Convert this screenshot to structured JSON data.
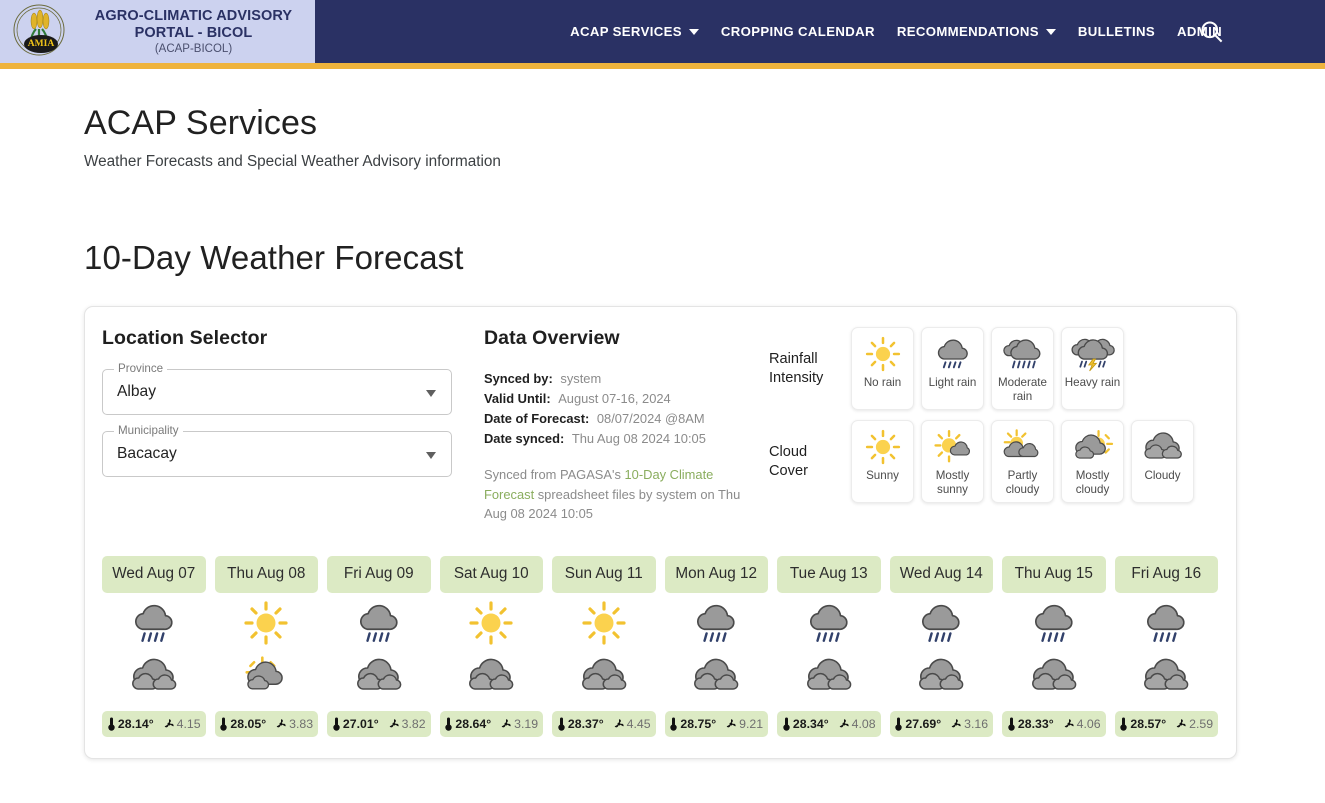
{
  "header": {
    "logo_icon": "pamia-seal-logo",
    "brand_title_line1": "AGRO-CLIMATIC ADVISORY",
    "brand_title_line2": "PORTAL - BICOL",
    "brand_subtitle": "(ACAP-BICOL)",
    "nav": [
      {
        "label": "ACAP SERVICES",
        "has_caret": true
      },
      {
        "label": "CROPPING CALENDAR",
        "has_caret": false
      },
      {
        "label": "RECOMMENDATIONS",
        "has_caret": true
      },
      {
        "label": "BULLETINS",
        "has_caret": false
      },
      {
        "label": "ADMIN",
        "has_caret": false
      }
    ],
    "search_icon": "search-icon",
    "bar_color": "#2a3164",
    "accent_color": "#eeb33c",
    "brand_bg": "#ccd2ef"
  },
  "page": {
    "title": "ACAP Services",
    "subtitle": "Weather Forecasts and Special Weather Advisory information",
    "forecast_heading": "10-Day Weather Forecast"
  },
  "location_selector": {
    "title": "Location Selector",
    "province": {
      "label": "Province",
      "value": "Albay"
    },
    "municipality": {
      "label": "Municipality",
      "value": "Bacacay"
    }
  },
  "data_overview": {
    "title": "Data Overview",
    "rows": [
      {
        "key": "Synced by:",
        "value": "system"
      },
      {
        "key": "Valid Until:",
        "value": "August 07-16, 2024"
      },
      {
        "key": "Date of Forecast:",
        "value": "08/07/2024 @8AM"
      },
      {
        "key": "Date synced:",
        "value": "Thu Aug 08 2024 10:05"
      }
    ],
    "note_pre": "Synced from PAGASA's ",
    "note_link": "10-Day Climate Forecast",
    "note_post": " spreadsheet files by system on Thu Aug 08 2024 10:05",
    "link_color": "#8aad5e"
  },
  "legend": {
    "rainfall": {
      "title_line1": "Rainfall",
      "title_line2": "Intensity",
      "items": [
        {
          "label": "No rain",
          "icon": "sun-icon"
        },
        {
          "label": "Light rain",
          "icon": "cloud-light-rain-icon"
        },
        {
          "label": "Moderate rain",
          "icon": "cloud-moderate-rain-icon"
        },
        {
          "label": "Heavy rain",
          "icon": "cloud-heavy-rain-lightning-icon"
        }
      ]
    },
    "cloud": {
      "title_line1": "Cloud",
      "title_line2": "Cover",
      "items": [
        {
          "label": "Sunny",
          "icon": "sun-icon"
        },
        {
          "label": "Mostly sunny",
          "icon": "sun-small-cloud-icon"
        },
        {
          "label": "Partly cloudy",
          "icon": "sun-behind-cloud-icon"
        },
        {
          "label": "Mostly cloudy",
          "icon": "cloud-with-sun-peek-icon"
        },
        {
          "label": "Cloudy",
          "icon": "cloudy-icon"
        }
      ]
    }
  },
  "forecast": {
    "chip_bg": "#dceac4",
    "temp_icon": "thermometer-icon",
    "wind_icon": "wind-icon",
    "days": [
      {
        "label": "Wed Aug 07",
        "rain_icon": "cloud-light-rain-icon",
        "cloud_icon": "cloudy-icon",
        "temp": "28.14°",
        "wind": "4.15"
      },
      {
        "label": "Thu Aug 08",
        "rain_icon": "sun-icon",
        "cloud_icon": "cloud-with-sun-peek-icon",
        "temp": "28.05°",
        "wind": "3.83"
      },
      {
        "label": "Fri Aug 09",
        "rain_icon": "cloud-light-rain-icon",
        "cloud_icon": "cloudy-icon",
        "temp": "27.01°",
        "wind": "3.82"
      },
      {
        "label": "Sat Aug 10",
        "rain_icon": "sun-icon",
        "cloud_icon": "cloudy-icon",
        "temp": "28.64°",
        "wind": "3.19"
      },
      {
        "label": "Sun Aug 11",
        "rain_icon": "sun-icon",
        "cloud_icon": "cloudy-icon",
        "temp": "28.37°",
        "wind": "4.45"
      },
      {
        "label": "Mon Aug 12",
        "rain_icon": "cloud-light-rain-icon",
        "cloud_icon": "cloudy-icon",
        "temp": "28.75°",
        "wind": "9.21"
      },
      {
        "label": "Tue Aug 13",
        "rain_icon": "cloud-light-rain-icon",
        "cloud_icon": "cloudy-icon",
        "temp": "28.34°",
        "wind": "4.08"
      },
      {
        "label": "Wed Aug 14",
        "rain_icon": "cloud-light-rain-icon",
        "cloud_icon": "cloudy-icon",
        "temp": "27.69°",
        "wind": "3.16"
      },
      {
        "label": "Thu Aug 15",
        "rain_icon": "cloud-light-rain-icon",
        "cloud_icon": "cloudy-icon",
        "temp": "28.33°",
        "wind": "4.06"
      },
      {
        "label": "Fri Aug 16",
        "rain_icon": "cloud-light-rain-icon",
        "cloud_icon": "cloudy-icon",
        "temp": "28.57°",
        "wind": "2.59"
      }
    ]
  }
}
